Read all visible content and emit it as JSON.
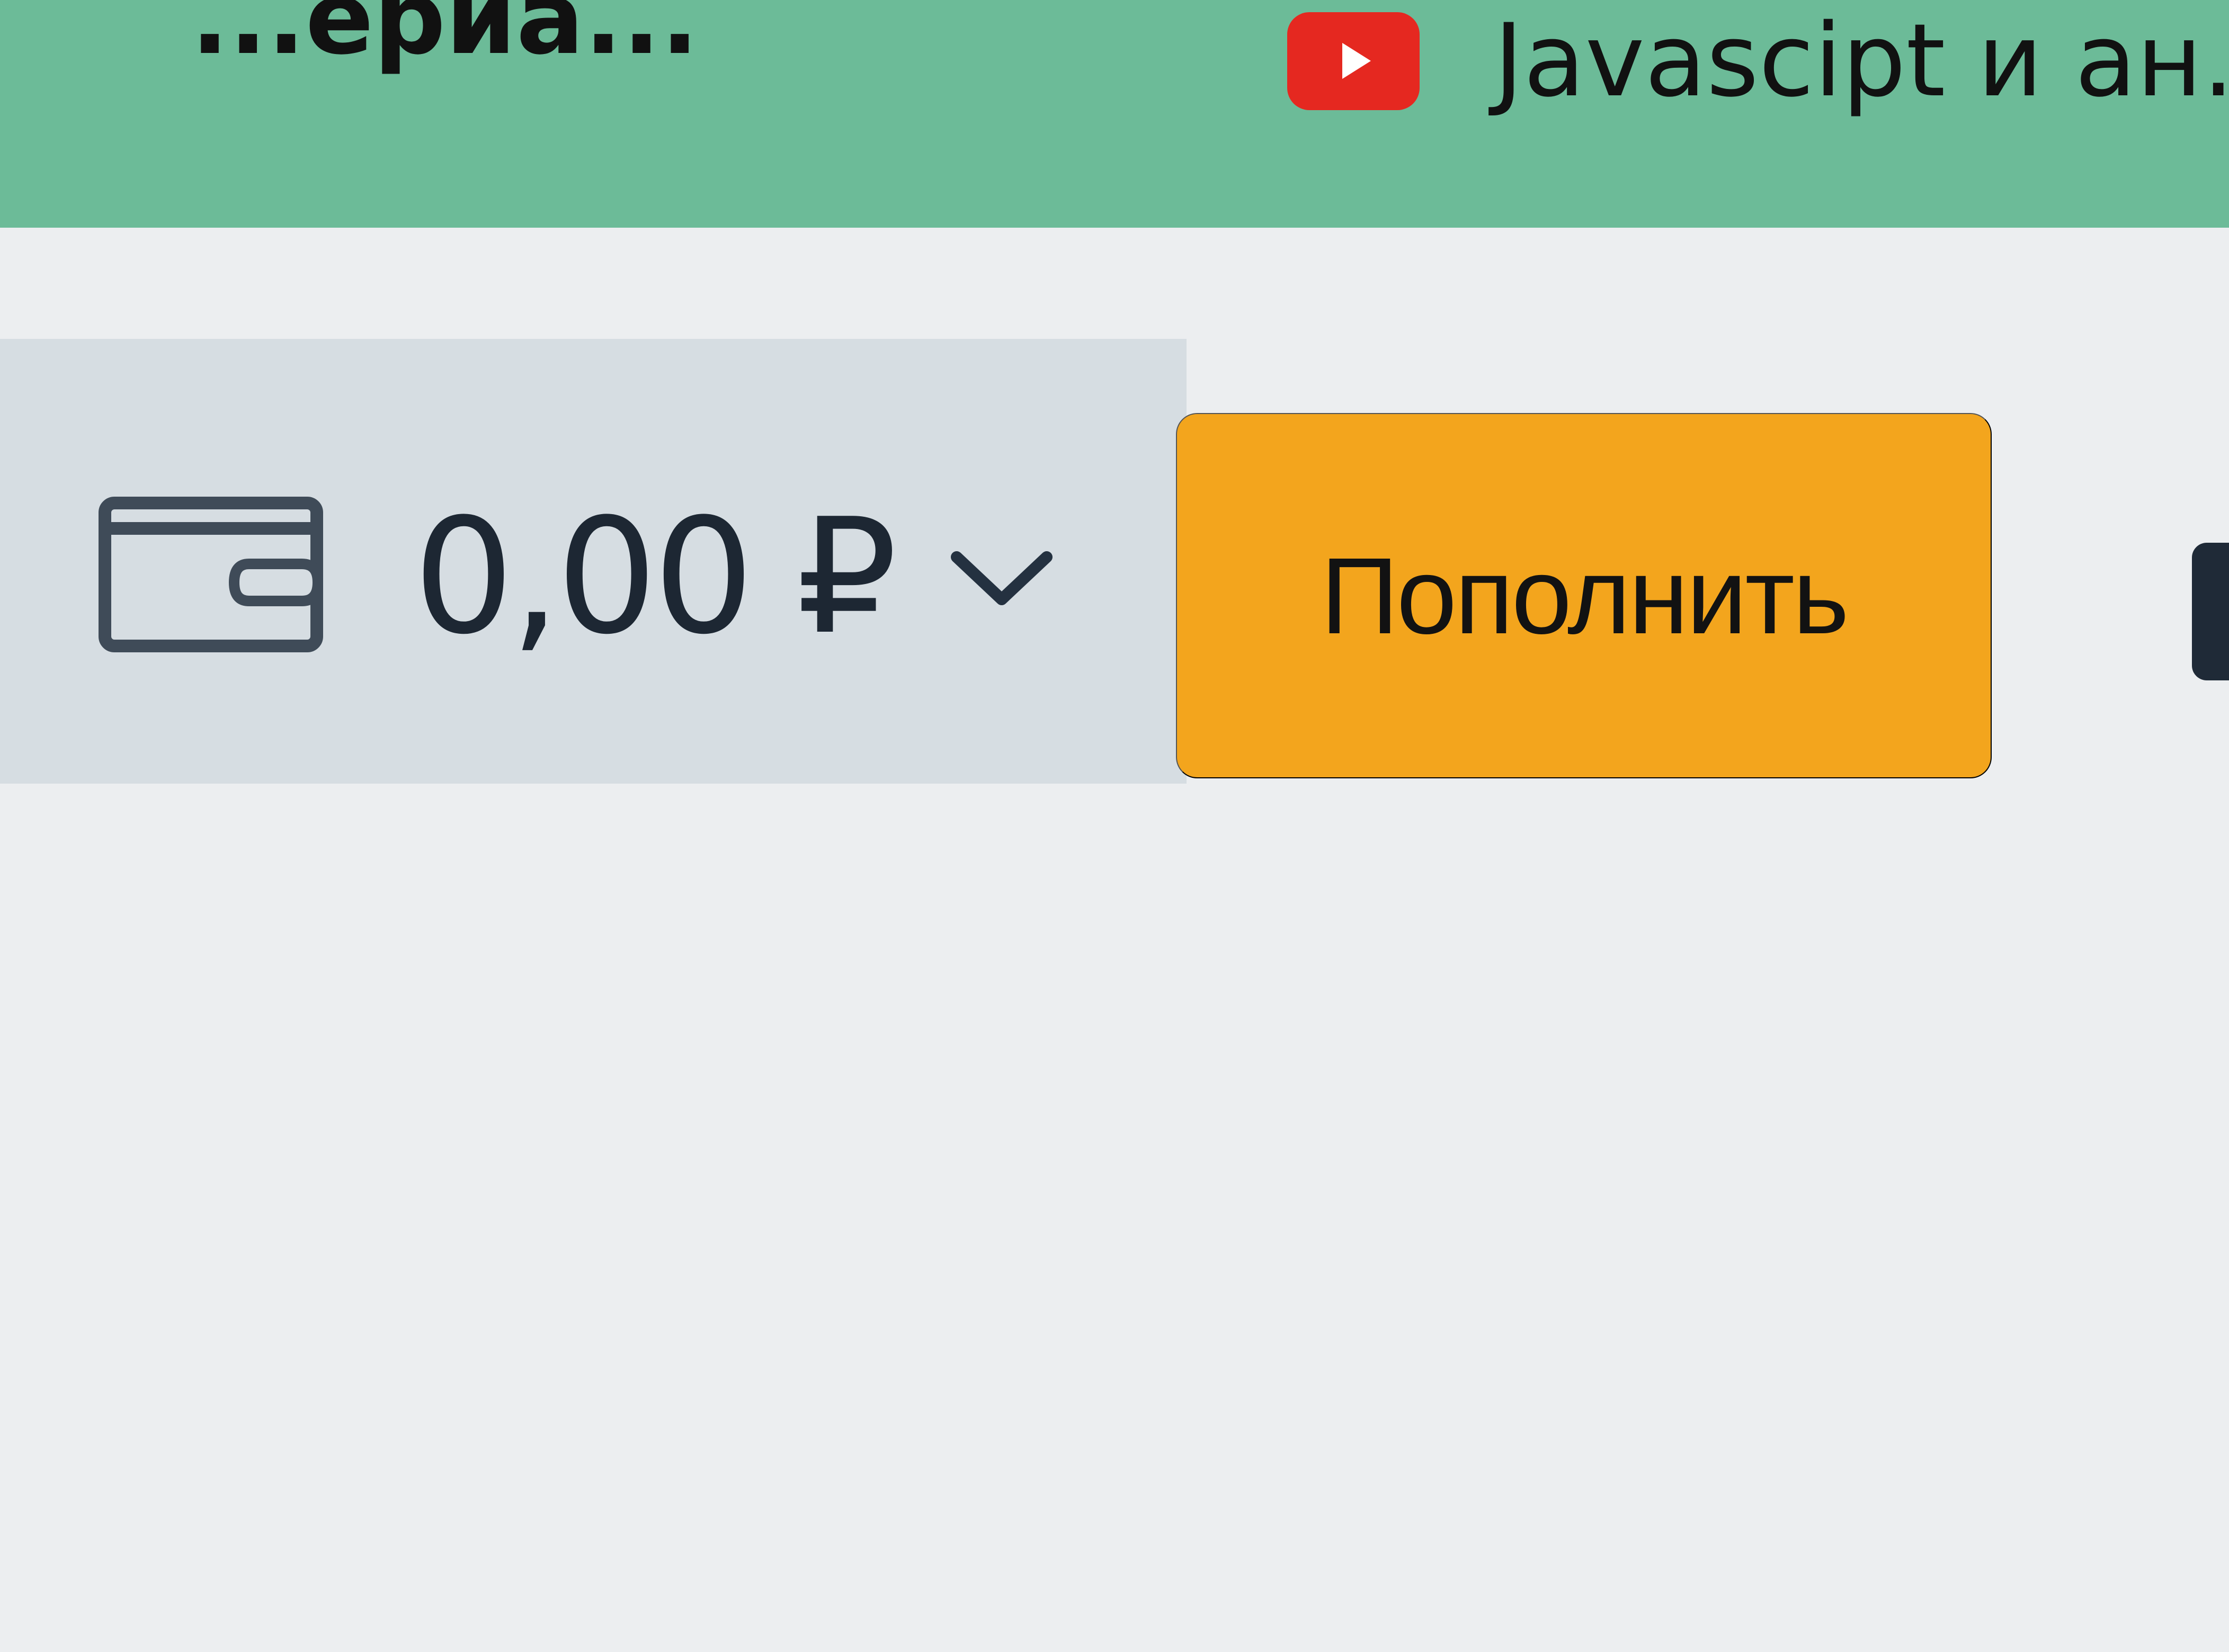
{
  "bookmarks_bar": {
    "items": [
      {
        "label": "...ериа...",
        "icon": "bookmark-icon"
      },
      {
        "label": "Javascipt и ан...",
        "icon": "youtube-icon"
      }
    ]
  },
  "wallet": {
    "icon": "wallet-icon",
    "balance": "0,00 ₽",
    "dropdown_icon": "chevron-down-icon"
  },
  "actions": {
    "top_up_label": "Пополнить"
  },
  "colors": {
    "bookmarks_bar": "#6cbb98",
    "toolbar_panel": "#d6dde2",
    "button": "#f3a51d",
    "youtube_red": "#e52820"
  }
}
